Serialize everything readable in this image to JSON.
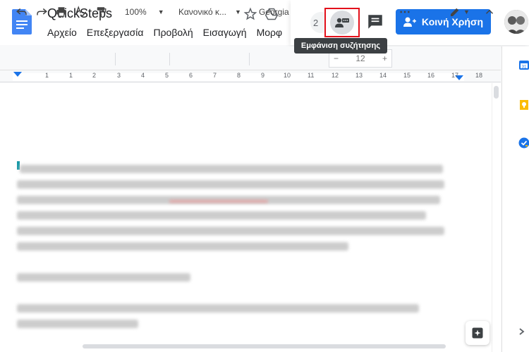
{
  "app": {
    "title": "QuickSteps",
    "menu": [
      "Αρχείο",
      "Επεξεργασία",
      "Προβολή",
      "Εισαγωγή",
      "Μορφ"
    ]
  },
  "header": {
    "viewers_count": "2",
    "tooltip": "Εμφάνιση συζήτησης",
    "share_label": "Κοινή Χρήση"
  },
  "toolbar": {
    "zoom": "100%",
    "style": "Κανονικό κ...",
    "font": "Georgia",
    "font_size": "12",
    "minus": "−",
    "plus": "+",
    "more": "⋯"
  },
  "ruler": {
    "numbers": [
      "1",
      "1",
      "2",
      "3",
      "4",
      "5",
      "6",
      "7",
      "8",
      "9",
      "10",
      "11",
      "12",
      "13",
      "14",
      "15",
      "16",
      "17",
      "18"
    ]
  },
  "colors": {
    "accent": "#1a73e8",
    "highlight_box": "#e3101b",
    "tooltip_bg": "#3c4043"
  },
  "icons": {
    "doc": "docs-icon",
    "star": "star-icon",
    "drive": "drive-icon",
    "discussion": "show-discussion-icon",
    "comment": "comment-icon",
    "share_person": "person-add-icon",
    "explore": "explore-icon"
  }
}
